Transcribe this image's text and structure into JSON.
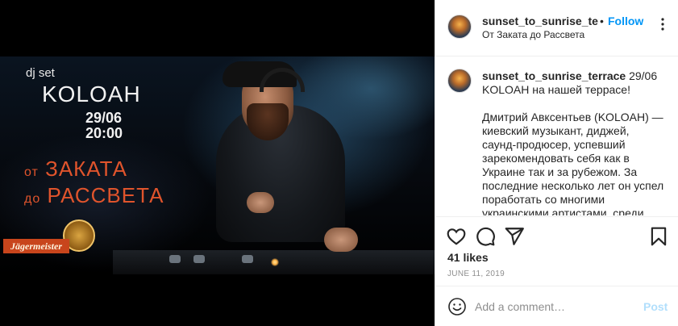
{
  "poster": {
    "dj_set": "dj set",
    "artist": "KOLOAH",
    "date": "29/06",
    "time": "20:00",
    "event_line1_small": "от",
    "event_line1_big": "ЗАКАТА",
    "event_line2_small": "до",
    "event_line2_big": "РАССВЕТА",
    "sponsor": "Jägermeister",
    "accent_color": "#e0542c"
  },
  "header": {
    "username": "sunset_to_sunrise_terrace",
    "separator": "•",
    "follow_label": "Follow",
    "location": "От Заката до Рассвета",
    "more_icon": "more-options-icon"
  },
  "caption": {
    "username": "sunset_to_sunrise_terrace",
    "date": "29/06",
    "first_line": "KOLOAH на нашей террасе!",
    "body": "Дмитрий Авксентьев (KOLOAH) — киевский музыкант, диджей, саунд-продюсер, успевший зарекомендовать себя как в Украине так и за рубежом. За последние несколько лет он успел поработать со многими украинскими артистами, среди"
  },
  "actions": {
    "like_icon": "heart-icon",
    "comment_icon": "comment-icon",
    "share_icon": "share-icon",
    "save_icon": "bookmark-icon",
    "likes": "41 likes",
    "post_date": "JUNE 11, 2019"
  },
  "add_comment": {
    "emoji_icon": "emoji-icon",
    "placeholder": "Add a comment…",
    "post_label": "Post"
  },
  "colors": {
    "link_blue": "#0095f6",
    "post_disabled": "#b2dffc",
    "muted": "#8e8e8e"
  }
}
